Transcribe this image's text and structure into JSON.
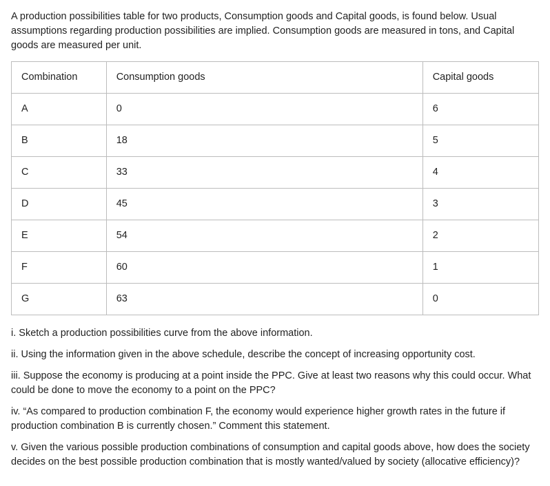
{
  "intro": "A production possibilities table for two products, Consumption goods and Capital goods, is found below. Usual assumptions regarding production possibilities are implied. Consumption goods are measured in tons, and Capital goods are measured per unit.",
  "table": {
    "headers": {
      "combination": "Combination",
      "consumption": "Consumption goods",
      "capital": "Capital goods"
    },
    "rows": [
      {
        "combo": "A",
        "cons": "0",
        "cap": "6"
      },
      {
        "combo": "B",
        "cons": "18",
        "cap": "5"
      },
      {
        "combo": "C",
        "cons": "33",
        "cap": "4"
      },
      {
        "combo": "D",
        "cons": "45",
        "cap": "3"
      },
      {
        "combo": "E",
        "cons": "54",
        "cap": "2"
      },
      {
        "combo": "F",
        "cons": "60",
        "cap": "1"
      },
      {
        "combo": "G",
        "cons": "63",
        "cap": "0"
      }
    ]
  },
  "questions": [
    "i. Sketch a production possibilities curve from the above information.",
    "ii. Using the information given in the above schedule, describe the concept of increasing opportunity cost.",
    "iii. Suppose the economy is producing at a point inside the PPC. Give at least two reasons why this could occur. What could be done to move the economy to a point on the PPC?",
    "iv. “As compared to production combination F, the economy would experience higher growth rates in the future if production combination B is currently chosen.” Comment this statement.",
    "v. Given the various possible production combinations of consumption and capital goods above, how does the society decides on the best possible production combination that is mostly wanted/valued by society (allocative efficiency)?"
  ]
}
